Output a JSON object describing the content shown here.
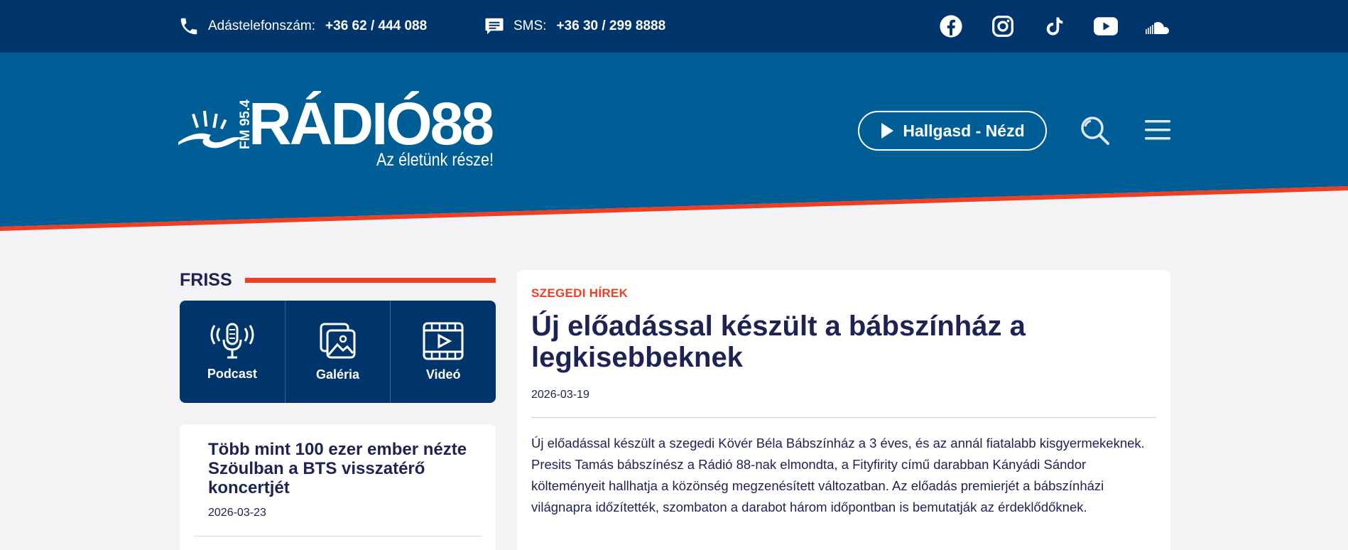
{
  "topbar": {
    "phone_label": "Adástelefonszám:",
    "phone_value": "+36 62 / 444 088",
    "sms_label": "SMS:",
    "sms_value": "+36 30 / 299 8888",
    "social": [
      "facebook-icon",
      "instagram-icon",
      "tiktok-icon",
      "youtube-icon",
      "soundcloud-icon"
    ]
  },
  "header": {
    "logo_fm": "FM 95.4",
    "logo_name": "RÁDIÓ88",
    "logo_slogan": "Az életünk része!",
    "listen_label": "Hallgasd - Nézd"
  },
  "sidebar": {
    "section_title": "FRISS",
    "media": [
      {
        "label": "Podcast",
        "icon": "microphone-icon"
      },
      {
        "label": "Galéria",
        "icon": "gallery-icon"
      },
      {
        "label": "Videó",
        "icon": "video-icon"
      }
    ],
    "news": [
      {
        "title": "Több mint 100 ezer ember nézte Szöulban a BTS visszatérő koncertjét",
        "date": "2026-03-23"
      }
    ]
  },
  "article": {
    "category": "SZEGEDI HÍREK",
    "title": "Új előadással készült a bábszínház a legkisebbeknek",
    "date": "2026-03-19",
    "body": "Új előadással készült a szegedi Kövér Béla Bábszínház a 3 éves, és az annál fiatalabb kisgyermekeknek. Presits Tamás bábszínész a Rádió 88-nak elmondta, a Fityfirity című darabban Kányádi Sándor költeményeit hallhatja a közönség megzenésített változatban. Az előadás premierjét a bábszínházi világnapra időzítették, szombaton a darabot három időpontban is bemutatják az érdeklődőknek."
  },
  "colors": {
    "topbar": "#00356b",
    "header": "#005e96",
    "accent": "#ef3e21",
    "text": "#1d2353"
  }
}
